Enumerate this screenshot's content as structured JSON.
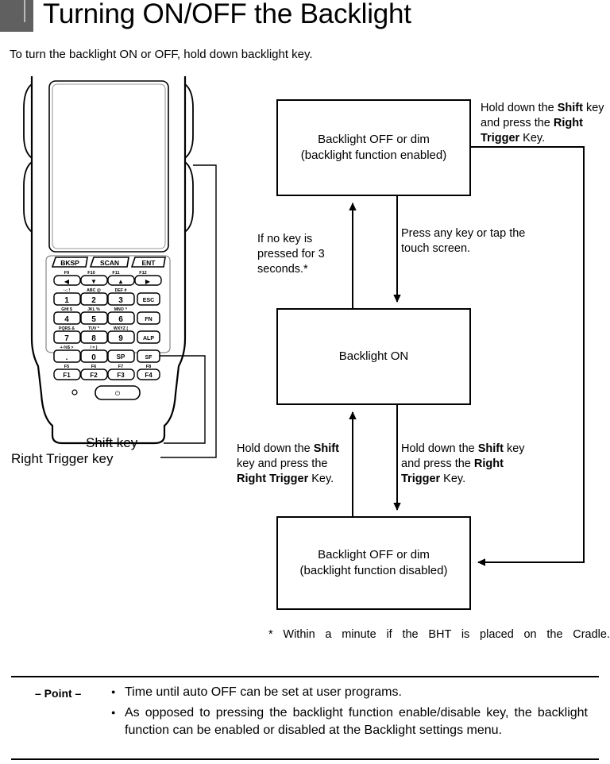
{
  "page": {
    "title": "Turning ON/OFF the Backlight",
    "intro": "To turn the backlight ON or OFF, hold down backlight key."
  },
  "device": {
    "callout_shift": "Shift key",
    "callout_right_trigger": "Right Trigger key",
    "keys": {
      "row_top": [
        "BKSP",
        "SCAN",
        "ENT"
      ],
      "fn_top": [
        "F9",
        "F10",
        "F11",
        "F12"
      ],
      "arrows": [
        "◀",
        "▼",
        "▲",
        "▶"
      ],
      "alpha_row1": [
        "˙-; !",
        "ABC @",
        "DEF #"
      ],
      "num_row1": [
        "1",
        "2",
        "3"
      ],
      "side_row1": "ESC",
      "alpha_row2": [
        "GHI $",
        "JKL %",
        "MNO ^"
      ],
      "num_row2": [
        "4",
        "5",
        "6"
      ],
      "side_row2": "FN",
      "alpha_row3": [
        "PQRS &",
        "TUV *",
        "WXYZ ("
      ],
      "num_row3": [
        "7",
        "8",
        "9"
      ],
      "side_row3": "ALP",
      "alpha_row4": [
        "+-%$ >",
        "/ = )",
        "",
        ""
      ],
      "num_row4": [
        ".",
        "0",
        "SP",
        "SF"
      ],
      "fn_bottom_small": [
        "F5",
        "F6",
        "F7",
        "F8"
      ],
      "fn_bottom": [
        "F1",
        "F2",
        "F3",
        "F4"
      ],
      "power": "⏻"
    }
  },
  "flowchart": {
    "boxes": {
      "top": {
        "line1": "Backlight OFF or dim",
        "line2": "(backlight function enabled)"
      },
      "middle": {
        "line1": "Backlight ON"
      },
      "bottom": {
        "line1": "Backlight OFF or dim",
        "line2": "(backlight function disabled)"
      }
    },
    "labels": {
      "top_right": {
        "part1": "Hold down the ",
        "bold1": "Shift",
        "part2": " key and press the ",
        "bold2": "Right Trigger",
        "part3": " Key."
      },
      "no_key": "If no key is pressed for 3 seconds.*",
      "press_any_key": "Press any key or tap the touch screen.",
      "on_to_off": {
        "part1": "Hold down the ",
        "bold1": "Shift",
        "part2": " key and press the ",
        "bold2": "Right Trigger",
        "part3": " Key."
      },
      "off_to_on": {
        "part1": "Hold down the ",
        "bold1": "Shift",
        "part2": " key and press the ",
        "bold2": "Right Trigger",
        "part3": " Key."
      }
    },
    "footnote": "*  Within a minute if the BHT is placed on the Cradle."
  },
  "point_section": {
    "label": "– Point –",
    "items": [
      "Time until auto OFF can be set at user programs.",
      "As opposed to pressing the backlight function enable/disable key, the backlight function can be enabled or disabled at the Backlight settings menu."
    ]
  }
}
